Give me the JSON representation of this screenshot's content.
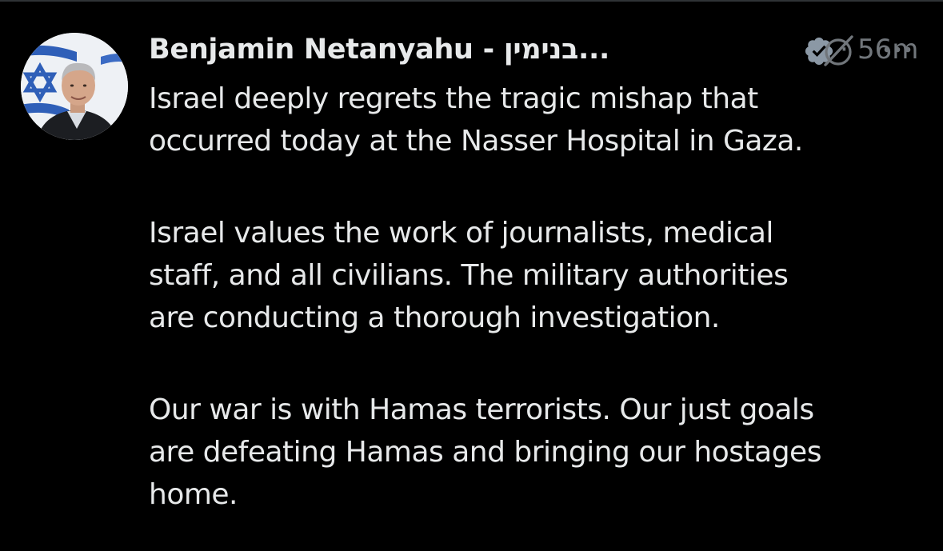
{
  "colors": {
    "background": "#000000",
    "text_primary": "#e7e9ea",
    "text_secondary": "#71767b",
    "verified_badge": "#8b98a5",
    "divider": "#2f3336"
  },
  "tweet": {
    "author": {
      "display_name": "Benjamin Netanyahu - בנימין...",
      "verified": true,
      "avatar_icon": "profile-photo"
    },
    "separator": "·",
    "timestamp": "56m",
    "actions": {
      "grok_icon": "grok-icon",
      "more_icon": "more-icon"
    },
    "paragraphs": [
      {
        "lines": [
          "Israel deeply regrets the tragic mishap that",
          "occurred today at the Nasser Hospital in Gaza."
        ]
      },
      {
        "lines": [
          "Israel values the work of journalists, medical",
          "staff, and all civilians. The military authorities",
          "are conducting a thorough investigation."
        ]
      },
      {
        "lines": [
          "Our war is with Hamas terrorists. Our just goals",
          "are defeating Hamas and bringing our hostages",
          "home."
        ]
      }
    ]
  }
}
